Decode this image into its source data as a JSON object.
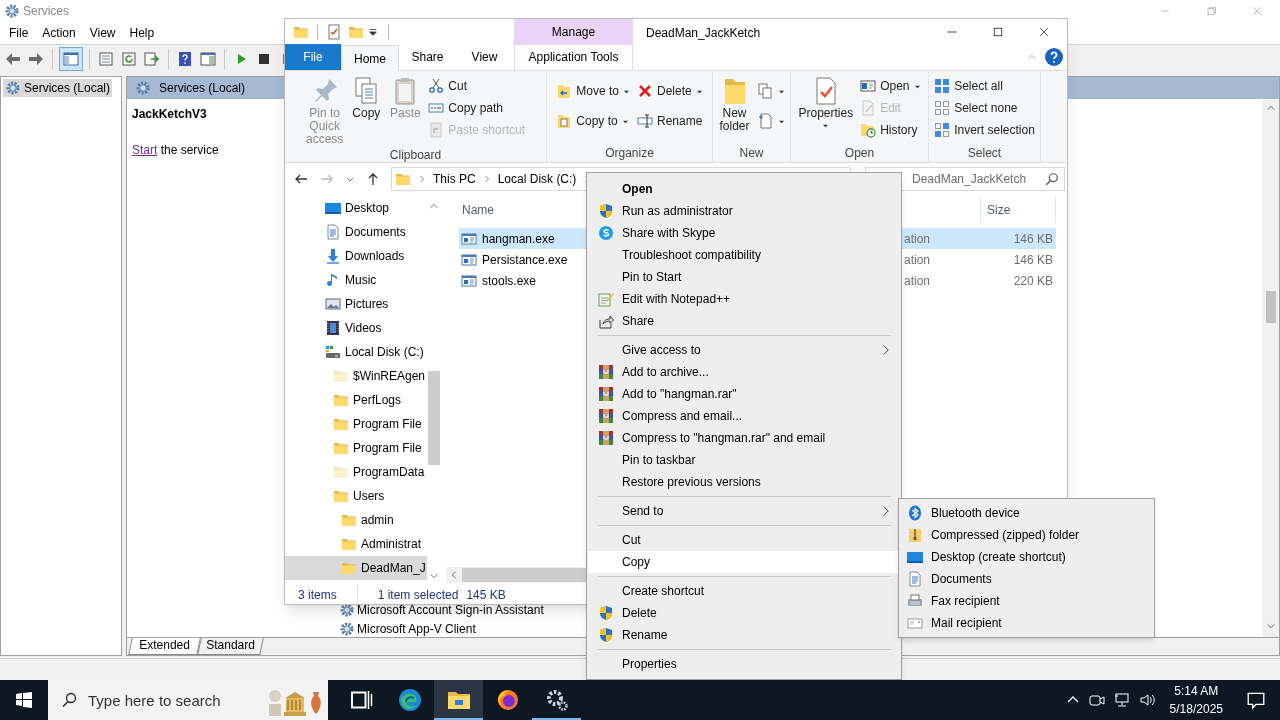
{
  "services": {
    "title": "Services",
    "menu": [
      "File",
      "Action",
      "View",
      "Help"
    ],
    "console_tree_toggle": {
      "selected": true
    },
    "tree": [
      {
        "label": "Services (Local)",
        "selected": true
      }
    ],
    "pane_title": "Services (Local)",
    "service_name": "JackKetchV3",
    "action_link": "Start",
    "action_rest": "the service",
    "list_rows": [
      "Microsoft Account Sign-in Assistant",
      "Microsoft App-V Client"
    ],
    "view_tabs": [
      {
        "label": "Extended",
        "selected": true
      },
      {
        "label": "Standard",
        "selected": false
      }
    ]
  },
  "explorer": {
    "title": "DeadMan_JackKetch",
    "contextual_header": "Manage",
    "ribbon_tabs": [
      {
        "label": "File",
        "kind": "file",
        "selected": false
      },
      {
        "label": "Home",
        "kind": "tab",
        "selected": true
      },
      {
        "label": "Share",
        "kind": "tab",
        "selected": false
      },
      {
        "label": "View",
        "kind": "tab",
        "selected": false
      },
      {
        "label": "Application Tools",
        "kind": "contextual",
        "selected": false
      }
    ],
    "ribbon_groups": [
      {
        "label": "Clipboard",
        "items": [
          {
            "kind": "large",
            "label": "Pin to Quick access",
            "disabled": true,
            "dropdown": false
          },
          {
            "kind": "large",
            "label": "Copy",
            "disabled": false,
            "dropdown": false
          },
          {
            "kind": "large",
            "label": "Paste",
            "disabled": true,
            "dropdown": false
          },
          {
            "kind": "column",
            "items": [
              {
                "label": "Cut",
                "disabled": false,
                "dropdown": false
              },
              {
                "label": "Copy path",
                "disabled": false,
                "dropdown": false
              },
              {
                "label": "Paste shortcut",
                "disabled": true,
                "dropdown": false
              }
            ]
          }
        ]
      },
      {
        "label": "Organize",
        "items": [
          {
            "kind": "column",
            "items": [
              {
                "label": "Move to",
                "disabled": false,
                "dropdown": true
              },
              {
                "label": "Copy to",
                "disabled": false,
                "dropdown": true
              }
            ]
          },
          {
            "kind": "column",
            "items": [
              {
                "label": "Delete",
                "disabled": false,
                "dropdown": true
              },
              {
                "label": "Rename",
                "disabled": false,
                "dropdown": false
              }
            ]
          }
        ]
      },
      {
        "label": "New",
        "items": [
          {
            "kind": "large",
            "label": "New folder",
            "disabled": false,
            "dropdown": false
          },
          {
            "kind": "column",
            "items": [
              {
                "disabled": false,
                "dropdown": true
              },
              {
                "disabled": false,
                "dropdown": true
              }
            ]
          }
        ]
      },
      {
        "label": "Open",
        "items": [
          {
            "kind": "large",
            "label": "Properties",
            "disabled": false,
            "dropdown": true
          },
          {
            "kind": "column",
            "items": [
              {
                "label": "Open",
                "disabled": false,
                "dropdown": true
              },
              {
                "label": "Edit",
                "disabled": true,
                "dropdown": false
              },
              {
                "label": "History",
                "disabled": false,
                "dropdown": false
              }
            ]
          }
        ]
      },
      {
        "label": "Select",
        "items": [
          {
            "kind": "column",
            "items": [
              {
                "label": "Select all",
                "disabled": false,
                "dropdown": false
              },
              {
                "label": "Select none",
                "disabled": false,
                "dropdown": false
              },
              {
                "label": "Invert selection",
                "disabled": false,
                "dropdown": false
              }
            ]
          }
        ]
      }
    ],
    "address": [
      "This PC",
      "Local Disk (C:)"
    ],
    "search": {
      "placeholder": "DeadMan_JackKetch"
    },
    "nav": [
      {
        "label": "Desktop",
        "selected": false
      },
      {
        "label": "Documents",
        "selected": false
      },
      {
        "label": "Downloads",
        "selected": false
      },
      {
        "label": "Music",
        "selected": false
      },
      {
        "label": "Pictures",
        "selected": false
      },
      {
        "label": "Videos",
        "selected": false
      },
      {
        "label": "Local Disk (C:)",
        "selected": false,
        "children": [
          {
            "label": "$WinREAgen",
            "hidden": true,
            "selected": false
          },
          {
            "label": "PerfLogs",
            "hidden": false,
            "selected": false
          },
          {
            "label": "Program File",
            "hidden": false,
            "selected": false
          },
          {
            "label": "Program File",
            "hidden": false,
            "selected": false
          },
          {
            "label": "ProgramData",
            "hidden": true,
            "selected": false
          },
          {
            "label": "Users",
            "hidden": false,
            "selected": false,
            "children": [
              {
                "label": "admin",
                "hidden": false,
                "selected": false
              },
              {
                "label": "Administrat",
                "hidden": false,
                "selected": false
              },
              {
                "label": "DeadMan_J",
                "hidden": false,
                "selected": true
              }
            ]
          }
        ]
      }
    ],
    "columns": [
      "Name",
      "Size"
    ],
    "files": [
      {
        "name": "hangman.exe",
        "column_3": "ation",
        "size": "146 KB",
        "selected": true
      },
      {
        "name": "Persistance.exe",
        "column_3": "ation",
        "size": "146 KB",
        "selected": false
      },
      {
        "name": "stools.exe",
        "column_3": "ation",
        "size": "220 KB",
        "selected": false
      }
    ],
    "status": {
      "count": "3 items",
      "selection": "1 item selected",
      "selection_size": "145 KB"
    }
  },
  "context_menu": {
    "groups": [
      [
        {
          "label": "Open",
          "kind": "plain",
          "default": true,
          "submenu": false,
          "selected": false
        },
        {
          "label": "Run as administrator",
          "kind": "shield",
          "default": false,
          "submenu": false,
          "selected": false
        },
        {
          "label": "Share with Skype",
          "kind": "skype",
          "default": false,
          "submenu": false,
          "selected": false
        },
        {
          "label": "Troubleshoot compatibility",
          "kind": "plain",
          "default": false,
          "submenu": false,
          "selected": false
        },
        {
          "label": "Pin to Start",
          "kind": "plain",
          "default": false,
          "submenu": false,
          "selected": false
        },
        {
          "label": "Edit with Notepad++",
          "kind": "notepad",
          "default": false,
          "submenu": false,
          "selected": false
        },
        {
          "label": "Share",
          "kind": "share",
          "default": false,
          "submenu": false,
          "selected": false
        }
      ],
      [
        {
          "label": "Give access to",
          "kind": "plain",
          "default": false,
          "submenu": true,
          "selected": false
        },
        {
          "label": "Add to archive...",
          "kind": "archive",
          "default": false,
          "submenu": false,
          "selected": false
        },
        {
          "label": "Add to \"hangman.rar\"",
          "kind": "archive",
          "default": false,
          "submenu": false,
          "selected": false
        },
        {
          "label": "Compress and email...",
          "kind": "archive",
          "default": false,
          "submenu": false,
          "selected": false
        },
        {
          "label": "Compress to \"hangman.rar\" and email",
          "kind": "archive",
          "default": false,
          "submenu": false,
          "selected": false
        },
        {
          "label": "Pin to taskbar",
          "kind": "plain",
          "default": false,
          "submenu": false,
          "selected": false
        },
        {
          "label": "Restore previous versions",
          "kind": "plain",
          "default": false,
          "submenu": false,
          "selected": false
        }
      ],
      [
        {
          "label": "Send to",
          "kind": "plain",
          "default": false,
          "submenu": true,
          "selected": false
        }
      ],
      [
        {
          "label": "Cut",
          "kind": "plain",
          "default": false,
          "submenu": false,
          "selected": false
        },
        {
          "label": "Copy",
          "kind": "plain",
          "default": false,
          "submenu": false,
          "selected": true
        }
      ],
      [
        {
          "label": "Create shortcut",
          "kind": "plain",
          "default": false,
          "submenu": false,
          "selected": false
        },
        {
          "label": "Delete",
          "kind": "shield",
          "default": false,
          "submenu": false,
          "selected": false
        },
        {
          "label": "Rename",
          "kind": "shield",
          "default": false,
          "submenu": false,
          "selected": false
        }
      ],
      [
        {
          "label": "Properties",
          "kind": "plain",
          "default": false,
          "submenu": false,
          "selected": false
        }
      ]
    ]
  },
  "send_to_menu": [
    {
      "label": "Bluetooth device",
      "kind": "bluetooth"
    },
    {
      "label": "Compressed (zipped) folder",
      "kind": "zip"
    },
    {
      "label": "Desktop (create shortcut)",
      "kind": "desktop"
    },
    {
      "label": "Documents",
      "kind": "documents"
    },
    {
      "label": "Fax recipient",
      "kind": "fax"
    },
    {
      "label": "Mail recipient",
      "kind": "mail"
    }
  ],
  "taskbar": {
    "search": {
      "placeholder": "Type here to search"
    },
    "apps": [
      {
        "kind": "taskview",
        "selected": false,
        "running": false
      },
      {
        "kind": "edge",
        "selected": false,
        "running": false
      },
      {
        "kind": "explorer",
        "selected": true,
        "running": true
      },
      {
        "kind": "firefox",
        "selected": false,
        "running": false
      },
      {
        "kind": "services",
        "selected": false,
        "running": true
      }
    ],
    "time": "5:14 AM",
    "date": "5/18/2025"
  }
}
